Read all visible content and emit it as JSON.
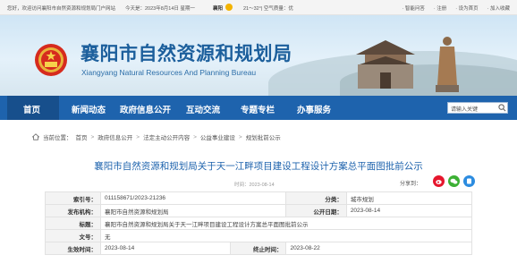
{
  "topbar": {
    "welcome": "您好，欢迎访问襄阳市自然资源和规划局门户网站",
    "date": "今天是：2023年8月14日 星期一",
    "city": "襄阳",
    "weather": "21～32°| 空气质量：优",
    "links": [
      "· 智能问答",
      "· 注册",
      "· 设为首页",
      "· 加入收藏"
    ]
  },
  "banner": {
    "title_cn": "襄阳市自然资源和规划局",
    "title_en": "Xiangyang Natural Resources And Planning Bureau"
  },
  "nav": {
    "items": [
      "首页",
      "新闻动态",
      "政府信息公开",
      "互动交流",
      "专题专栏",
      "办事服务"
    ],
    "search_placeholder": "请输入关键"
  },
  "breadcrumb": {
    "label": "当前位置：",
    "items": [
      "首页",
      "政府信息公开",
      "法定主动公开内容",
      "公益事业建设",
      "规划批前公示"
    ]
  },
  "article": {
    "title": "襄阳市自然资源和规划局关于天一江畔项目建设工程设计方案总平面图批前公示",
    "date": "时间：2023-08-14",
    "share_label": "分享到："
  },
  "info": {
    "index_label": "索引号：",
    "index_value": "011158671/2023-21236",
    "category_label": "分类：",
    "category_value": "城市规划",
    "publisher_label": "发布机构：",
    "publisher_value": "襄阳市自然资源和规划局",
    "pubdate_label": "公开日期：",
    "pubdate_value": "2023-08-14",
    "title_label": "标题：",
    "title_value": "襄阳市自然资源和规划局关于天一江畔项目建设工程设计方案总平面图批前公示",
    "docno_label": "文号：",
    "docno_value": "无",
    "effective_label": "生效时间：",
    "effective_value": "2023-08-14",
    "expire_label": "终止时间：",
    "expire_value": "2023-08-22"
  },
  "colors": {
    "nav": "#1e63ad",
    "title": "#1c5f9c",
    "weibo": "#e6162d",
    "wechat": "#3cb034",
    "qq": "#2c8ce0"
  }
}
